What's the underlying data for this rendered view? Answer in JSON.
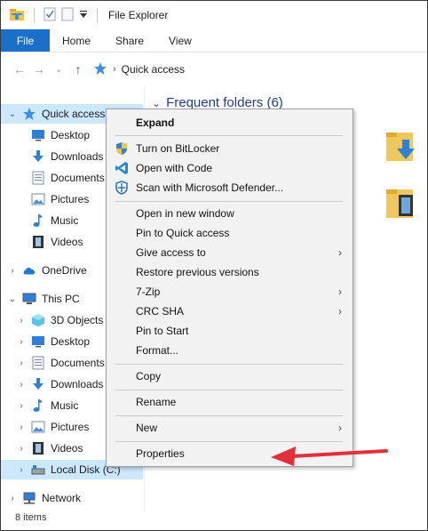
{
  "window": {
    "title": "File Explorer"
  },
  "ribbon": {
    "tabs": [
      "File",
      "Home",
      "Share",
      "View"
    ]
  },
  "address": {
    "location": "Quick access"
  },
  "nav": {
    "items": [
      {
        "label": "Quick access",
        "icon": "star-icon",
        "expanded": true,
        "selected": true
      },
      {
        "label": "Desktop",
        "icon": "desktop-icon"
      },
      {
        "label": "Downloads",
        "icon": "download-icon"
      },
      {
        "label": "Documents",
        "icon": "document-icon"
      },
      {
        "label": "Pictures",
        "icon": "picture-icon"
      },
      {
        "label": "Music",
        "icon": "music-icon"
      },
      {
        "label": "Videos",
        "icon": "video-icon"
      },
      {
        "label": "OneDrive",
        "icon": "cloud-icon"
      },
      {
        "label": "This PC",
        "icon": "pc-icon",
        "expanded": true
      },
      {
        "label": "3D Objects",
        "icon": "cube-icon"
      },
      {
        "label": "Desktop",
        "icon": "desktop-icon"
      },
      {
        "label": "Documents",
        "icon": "document-icon"
      },
      {
        "label": "Downloads",
        "icon": "download-icon"
      },
      {
        "label": "Music",
        "icon": "music-icon"
      },
      {
        "label": "Pictures",
        "icon": "picture-icon"
      },
      {
        "label": "Videos",
        "icon": "video-icon"
      },
      {
        "label": "Local Disk (C:)",
        "icon": "drive-icon",
        "selected": true
      },
      {
        "label": "Network",
        "icon": "network-icon"
      }
    ]
  },
  "content": {
    "group_header": "Frequent folders (6)"
  },
  "status": {
    "items_count": "8 items"
  },
  "context_menu": {
    "items": [
      {
        "label": "Expand",
        "bold": true
      },
      {
        "label": "Turn on BitLocker",
        "icon": "shield-icon"
      },
      {
        "label": "Open with Code",
        "icon": "vscode-icon"
      },
      {
        "label": "Scan with Microsoft Defender...",
        "icon": "defender-icon"
      },
      {
        "label": "Open in new window"
      },
      {
        "label": "Pin to Quick access"
      },
      {
        "label": "Give access to",
        "submenu": true
      },
      {
        "label": "Restore previous versions"
      },
      {
        "label": "7-Zip",
        "submenu": true
      },
      {
        "label": "CRC SHA",
        "submenu": true
      },
      {
        "label": "Pin to Start"
      },
      {
        "label": "Format..."
      },
      {
        "label": "Copy"
      },
      {
        "label": "Rename"
      },
      {
        "label": "New",
        "submenu": true
      },
      {
        "label": "Properties"
      }
    ]
  },
  "colors": {
    "accent": "#1a6fc9",
    "selection": "#cce8ff",
    "annotation_arrow": "#e0303a",
    "folder": "#f0c75e"
  }
}
